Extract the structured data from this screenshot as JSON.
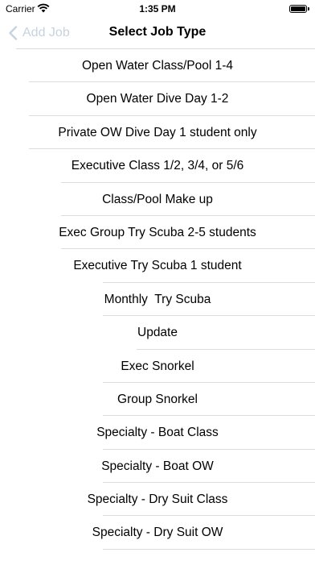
{
  "status_bar": {
    "carrier": "Carrier",
    "time": "1:35 PM",
    "wifi_icon": "wifi-icon",
    "battery_icon": "battery-icon",
    "battery_level": 1.0
  },
  "nav": {
    "back_label": "Add Job",
    "back_icon": "chevron-left-icon",
    "title": "Select Job Type",
    "back_color": "#c7d3df"
  },
  "job_types": [
    "Open Water Class/Pool 1-4",
    "Open Water Dive Day 1-2",
    "Private OW Dive Day 1 student only",
    "Executive Class 1/2, 3/4, or 5/6",
    "Class/Pool Make up",
    "Exec Group Try Scuba 2-5 students",
    "Executive Try Scuba 1 student",
    "Monthly  Try Scuba",
    "Update",
    "Exec Snorkel",
    "Group Snorkel",
    "Specialty - Boat Class",
    "Specialty - Boat OW",
    "Specialty - Dry Suit Class",
    "Specialty - Dry Suit OW"
  ]
}
